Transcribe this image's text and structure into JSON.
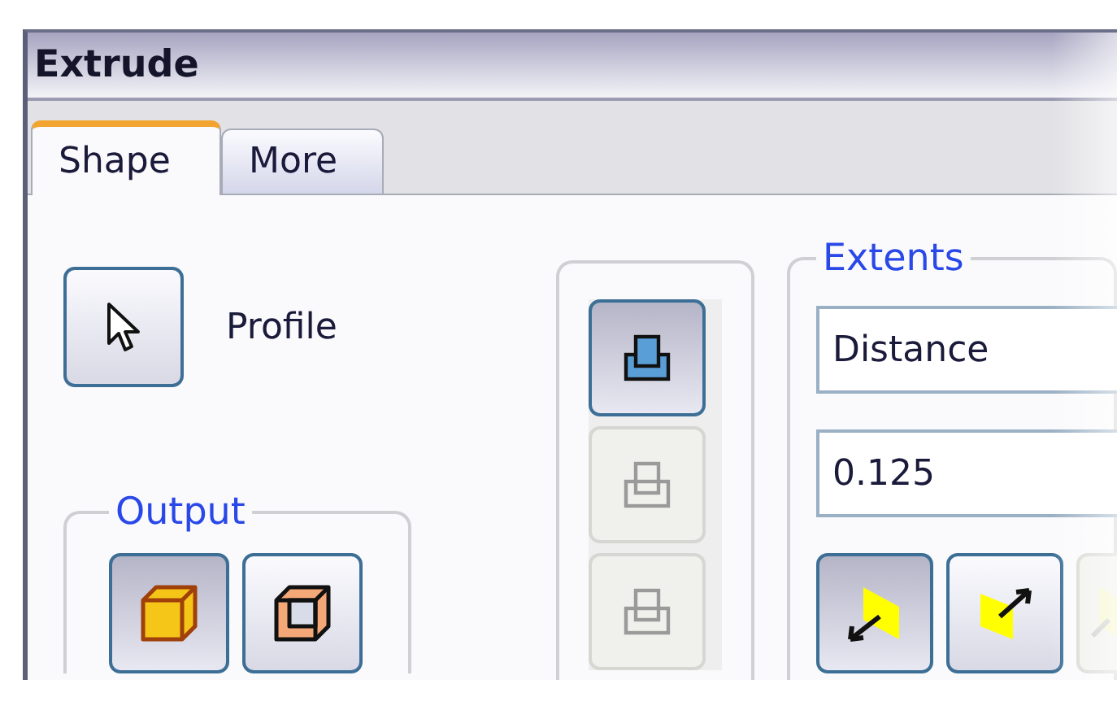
{
  "window": {
    "title": "Extrude"
  },
  "tabs": [
    {
      "label": "Shape",
      "selected": true
    },
    {
      "label": "More",
      "selected": false
    }
  ],
  "profile": {
    "label": "Profile"
  },
  "output": {
    "legend": "Output",
    "buttons": [
      {
        "kind": "solid",
        "selected": true
      },
      {
        "kind": "surface",
        "selected": false
      }
    ]
  },
  "operation": {
    "buttons": [
      {
        "selected": true,
        "disabled": false
      },
      {
        "selected": false,
        "disabled": true
      },
      {
        "selected": false,
        "disabled": true
      }
    ]
  },
  "extents": {
    "legend": "Extents",
    "type": "Distance",
    "distance": "0.125",
    "directions": [
      {
        "kind": "default",
        "selected": true,
        "disabled": false
      },
      {
        "kind": "flipped",
        "selected": false,
        "disabled": false
      },
      {
        "kind": "symmetric",
        "selected": false,
        "disabled": true
      }
    ]
  }
}
